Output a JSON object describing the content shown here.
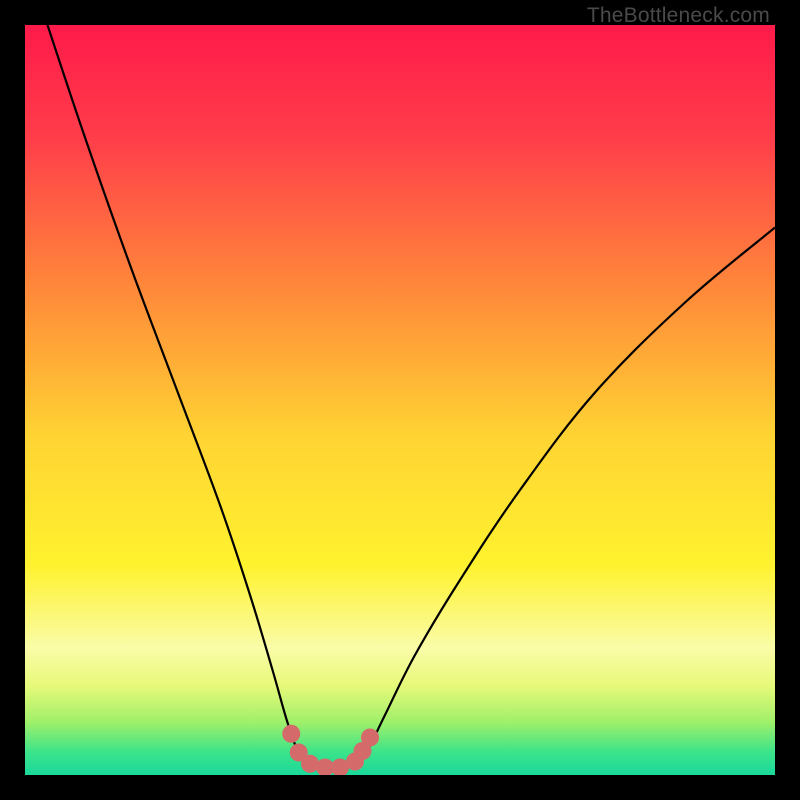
{
  "watermark": "TheBottleneck.com",
  "chart_data": {
    "type": "line",
    "title": "",
    "xlabel": "",
    "ylabel": "",
    "xlim": [
      0,
      100
    ],
    "ylim": [
      0,
      100
    ],
    "background_gradient": {
      "stops": [
        {
          "offset": 0,
          "color": "#ff1a4a"
        },
        {
          "offset": 0.15,
          "color": "#ff3d4a"
        },
        {
          "offset": 0.35,
          "color": "#ff883a"
        },
        {
          "offset": 0.55,
          "color": "#ffd433"
        },
        {
          "offset": 0.72,
          "color": "#fff22e"
        },
        {
          "offset": 0.83,
          "color": "#fafca8"
        },
        {
          "offset": 0.88,
          "color": "#e8f97a"
        },
        {
          "offset": 0.93,
          "color": "#9ef06a"
        },
        {
          "offset": 0.97,
          "color": "#3be38a"
        },
        {
          "offset": 1.0,
          "color": "#1ad99a"
        }
      ]
    },
    "curve": {
      "description": "V-shaped bottleneck curve",
      "points_left": [
        {
          "x": 3,
          "y": 100
        },
        {
          "x": 8,
          "y": 85
        },
        {
          "x": 14,
          "y": 68
        },
        {
          "x": 20,
          "y": 52
        },
        {
          "x": 26,
          "y": 36
        },
        {
          "x": 30,
          "y": 24
        },
        {
          "x": 33,
          "y": 14
        },
        {
          "x": 35,
          "y": 7
        },
        {
          "x": 36.5,
          "y": 3
        }
      ],
      "points_bottom": [
        {
          "x": 36.5,
          "y": 3
        },
        {
          "x": 38,
          "y": 1.5
        },
        {
          "x": 40,
          "y": 1
        },
        {
          "x": 42,
          "y": 1
        },
        {
          "x": 44,
          "y": 1.5
        },
        {
          "x": 45.5,
          "y": 3
        }
      ],
      "points_right": [
        {
          "x": 45.5,
          "y": 3
        },
        {
          "x": 48,
          "y": 8
        },
        {
          "x": 52,
          "y": 16
        },
        {
          "x": 58,
          "y": 26
        },
        {
          "x": 66,
          "y": 38
        },
        {
          "x": 76,
          "y": 51
        },
        {
          "x": 88,
          "y": 63
        },
        {
          "x": 100,
          "y": 73
        }
      ]
    },
    "markers": [
      {
        "x": 35.5,
        "y": 5.5
      },
      {
        "x": 36.5,
        "y": 3
      },
      {
        "x": 38,
        "y": 1.5
      },
      {
        "x": 40,
        "y": 1
      },
      {
        "x": 42,
        "y": 1
      },
      {
        "x": 44,
        "y": 1.8
      },
      {
        "x": 45,
        "y": 3.2
      },
      {
        "x": 46,
        "y": 5
      }
    ],
    "marker_color": "#d46a6a",
    "marker_radius": 9
  }
}
